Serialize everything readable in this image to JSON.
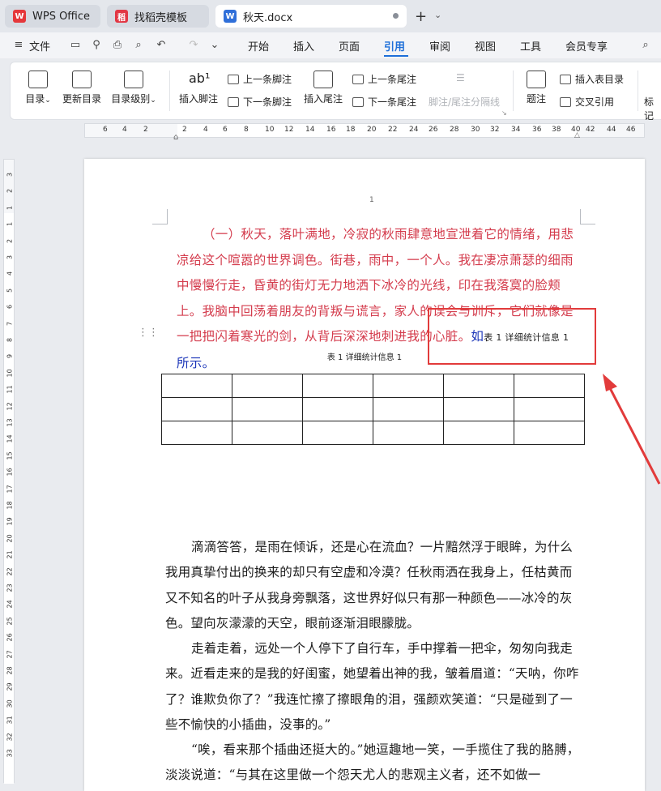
{
  "tabs": [
    {
      "label": "WPS Office",
      "icon": "wps-logo-icon",
      "color": "#e5383b"
    },
    {
      "label": "找稻壳模板",
      "icon": "docer-logo-icon",
      "color": "#e23744"
    },
    {
      "label": "秋天.docx",
      "icon": "word-doc-icon",
      "color": "#2f6fd9"
    }
  ],
  "menu": {
    "file": "文件",
    "items": [
      "开始",
      "插入",
      "页面",
      "引用",
      "审阅",
      "视图",
      "工具",
      "会员专享"
    ],
    "active": "引用"
  },
  "ribbon": {
    "toc": "目录",
    "update_toc": "更新目录",
    "toc_level": "目录级别",
    "insert_footnote": "插入脚注",
    "prev_footnote": "上一条脚注",
    "next_footnote": "下一条脚注",
    "insert_endnote": "插入尾注",
    "prev_endnote": "上一条尾注",
    "next_endnote": "下一条尾注",
    "separator": "脚注/尾注分隔线",
    "caption": "题注",
    "insert_table_toc": "插入表目录",
    "cross_ref": "交叉引用",
    "mark": "标记"
  },
  "ruler": {
    "h_numbers": [
      "6",
      "4",
      "2",
      "2",
      "4",
      "6",
      "8",
      "10",
      "12",
      "14",
      "16",
      "18",
      "20",
      "22",
      "24",
      "26",
      "28",
      "30",
      "32",
      "34",
      "36",
      "38",
      "40",
      "42",
      "44",
      "46"
    ],
    "v_numbers": [
      "3",
      "2",
      "1",
      "1",
      "2",
      "3",
      "4",
      "5",
      "6",
      "7",
      "8",
      "9",
      "10",
      "11",
      "12",
      "13",
      "14",
      "15",
      "16",
      "17",
      "18",
      "19",
      "20",
      "21",
      "22",
      "23",
      "24",
      "25",
      "26",
      "27",
      "28",
      "29",
      "30",
      "31",
      "32",
      "33"
    ]
  },
  "document": {
    "page_number": "1",
    "red_paragraph_start": "（一）秋天，落叶满地，冷寂的秋雨肆意地宣泄着它的情绪，用悲凉给这个喧嚣的世界调色。街巷，雨中，一个人。我在凄凉萧瑟的细雨中慢慢行走，昏黄的街灯无力地洒下冰冷的光线，印在我落寞的脸颊上。我脑中回荡着朋友的背叛与谎言，家人的误会与训斥，它们就像是一把把闪着寒光的剑，从背后深深地刺进我的心脏。",
    "blue_before": "如",
    "inserted_ref": "表 1 详细统计信息  1",
    "blue_after": "所示。",
    "caption": "表 1 详细统计信息 1",
    "paragraphs": [
      "滴滴答答，是雨在倾诉，还是心在流血？一片黯然浮于眼眸，为什么我用真挚付出的换来的却只有空虚和冷漠？任秋雨洒在我身上，任枯黄而又不知名的叶子从我身旁飘落，这世界好似只有那一种颜色——冰冷的灰色。望向灰濛濛的天空，眼前逐渐泪眼朦胧。",
      "走着走着，远处一个人停下了自行车，手中撑着一把伞，匆匆向我走来。近看走来的是我的好闺蜜，她望着出神的我，皱着眉道：“天呐，你咋了？谁欺负你了？”我连忙擦了擦眼角的泪，强颜欢笑道：“只是碰到了一些不愉快的小插曲，没事的。”",
      "“唉，看来那个插曲还挺大的。”她逗趣地一笑，一手揽住了我的胳膊，淡淡说道：“与其在这里做一个怨天尤人的悲观主义者，还不如做一"
    ]
  },
  "annotation_color": "#e23b3b"
}
